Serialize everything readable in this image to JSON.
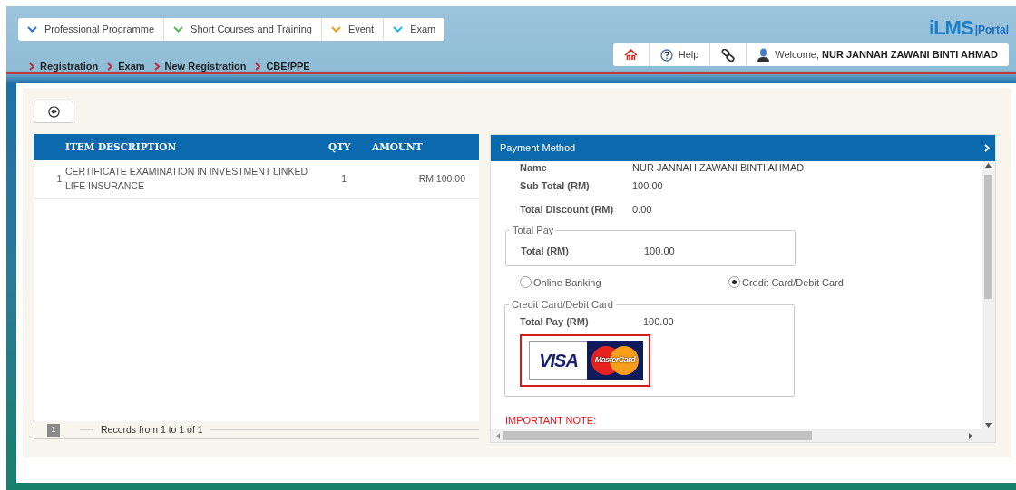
{
  "menu": [
    {
      "label": "Professional Programme",
      "color": "#2f6fd6"
    },
    {
      "label": "Short Courses and Training",
      "color": "#5cb85c"
    },
    {
      "label": "Event",
      "color": "#f0a020"
    },
    {
      "label": "Exam",
      "color": "#29b6e0"
    }
  ],
  "breadcrumb": [
    "Registration",
    "Exam",
    "New Registration",
    "CBE/PPE"
  ],
  "logo": {
    "brand": "iLMS",
    "suffix": "|Portal"
  },
  "toolbar": {
    "help": "Help",
    "welcome": "Welcome,",
    "user": "NUR JANNAH ZAWANI BINTI AHMAD"
  },
  "items_table": {
    "columns": [
      "ITEM DESCRIPTION",
      "QTY",
      "AMOUNT"
    ],
    "rows": [
      {
        "no": "1",
        "description": "CERTIFICATE EXAMINATION IN INVESTMENT LINKED LIFE INSURANCE",
        "qty": "1",
        "amount": "RM 100.00"
      }
    ],
    "pager": {
      "page": "1",
      "records": "Records from 1 to 1 of 1"
    }
  },
  "payment": {
    "title": "Payment Method",
    "fields": [
      {
        "label": "Name",
        "value": "NUR JANNAH ZAWANI BINTI AHMAD"
      },
      {
        "label": "Sub Total (RM)",
        "value": "100.00"
      },
      {
        "label": "Total Discount (RM)",
        "value": "0.00"
      }
    ],
    "total_pay": {
      "legend": "Total Pay",
      "label": "Total (RM)",
      "value": "100.00"
    },
    "methods": [
      {
        "label": "Online Banking",
        "selected": false
      },
      {
        "label": "Credit Card/Debit Card",
        "selected": true
      }
    ],
    "card_section": {
      "legend": "Credit Card/Debit Card",
      "label": "Total Pay (RM)",
      "value": "100.00",
      "visa": "VISA",
      "mastercard": "MasterCard"
    },
    "note": "IMPORTANT NOTE:"
  }
}
